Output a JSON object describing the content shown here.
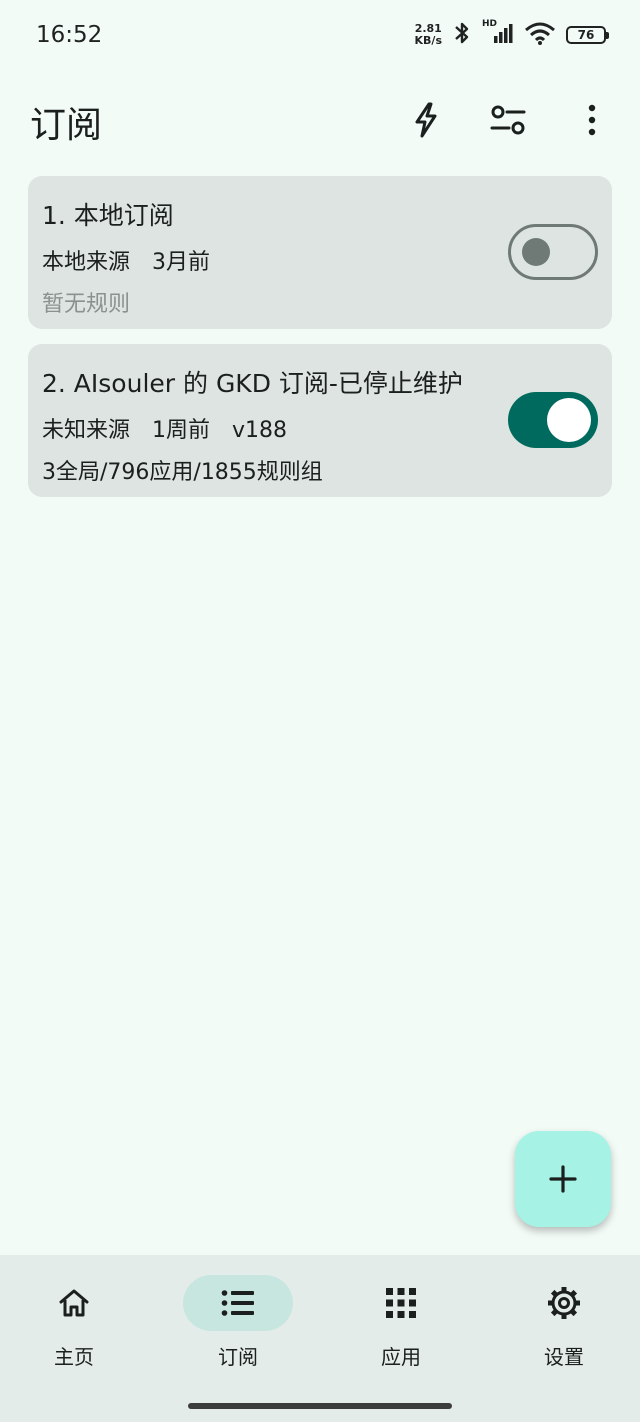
{
  "status_bar": {
    "time": "16:52",
    "net_speed_value": "2.81",
    "net_speed_unit": "KB/s",
    "hd_label": "HD",
    "battery": "76"
  },
  "header": {
    "title": "订阅"
  },
  "subscriptions": [
    {
      "title": "1. 本地订阅",
      "source": "本地来源",
      "time": "3月前",
      "version": "",
      "rules": "暂无规则",
      "enabled": false
    },
    {
      "title": "2. AIsouler 的 GKD 订阅-已停止维护",
      "source": "未知来源",
      "time": "1周前",
      "version": "v188",
      "rules": "3全局/796应用/1855规则组",
      "enabled": true
    }
  ],
  "bottom_nav": [
    {
      "label": "主页",
      "icon": "home-icon"
    },
    {
      "label": "订阅",
      "icon": "list-icon",
      "active": true
    },
    {
      "label": "应用",
      "icon": "apps-grid-icon"
    },
    {
      "label": "设置",
      "icon": "gear-icon"
    }
  ],
  "colors": {
    "background": "#F3FBF7",
    "card": "#DDE4E1",
    "accent": "#006A5E",
    "fab": "#A6F2E4",
    "nav_active": "#C8E6E0"
  }
}
